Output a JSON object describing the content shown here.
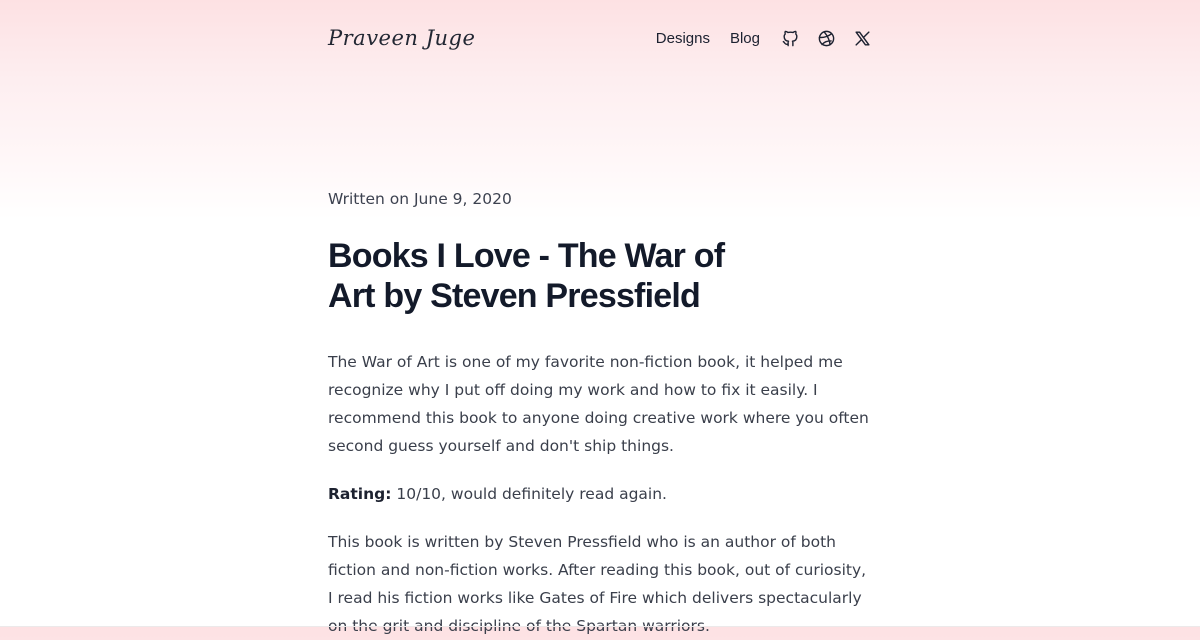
{
  "site": {
    "logo": "Praveen Juge",
    "nav": {
      "designs": "Designs",
      "blog": "Blog"
    },
    "social_icons": [
      "github-icon",
      "dribbble-icon",
      "x-icon"
    ]
  },
  "post": {
    "written_on": "Written on June 9, 2020",
    "title": "Books I Love - The War of Art by Steven Pressfield",
    "paragraph_1": "The War of Art is one of my favorite non-fiction book, it helped me recognize why I put off doing my work and how to fix it easily. I recommend this book to anyone doing creative work where you often second guess yourself and don't ship things.",
    "rating_label": "Rating:",
    "rating_text": " 10/10, would definitely read again.",
    "paragraph_3": "This book is written by Steven Pressfield who is an author of both fiction and non-fiction works. After reading this book, out of curiosity, I read his fiction works like Gates of Fire which delivers spectacularly on the grit and discipline of the Spartan warriors."
  },
  "colors": {
    "header_gradient_top": "#fde1e3",
    "text_dark": "#131a2a",
    "text_body": "#3a3f4b"
  }
}
